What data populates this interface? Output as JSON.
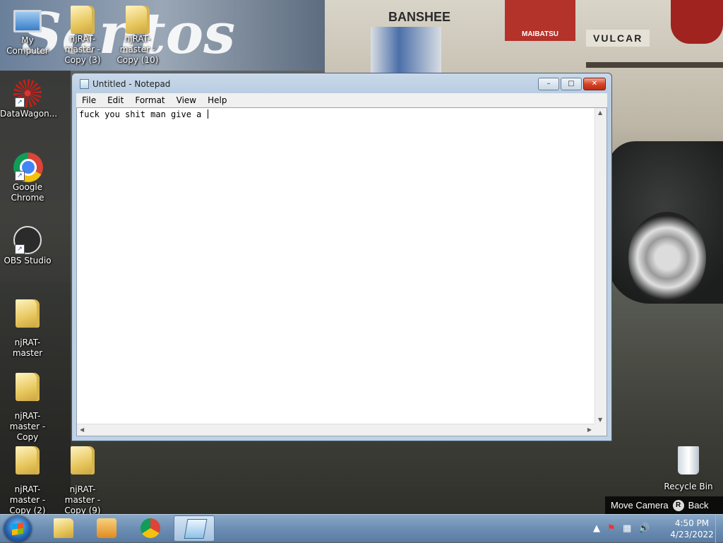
{
  "wallpaper": {
    "sign_banshee": "BANSHEE",
    "sign_maibatsu": "MAIBATSU",
    "sign_vulcar": "VULCAR",
    "santos_text": "Santos"
  },
  "desktop_icons": [
    {
      "label": "My Computer",
      "kind": "computer"
    },
    {
      "label": "njRAT-master - Copy (3)",
      "kind": "folder"
    },
    {
      "label": "njRAT-master - Copy (10)",
      "kind": "folder"
    },
    {
      "label": "DataWagon...",
      "kind": "datawagon"
    },
    {
      "label": "Google Chrome",
      "kind": "chrome"
    },
    {
      "label": "OBS Studio",
      "kind": "obs"
    },
    {
      "label": "njRAT-master",
      "kind": "folder"
    },
    {
      "label": "njRAT-master - Copy",
      "kind": "folder"
    },
    {
      "label": "njRAT-master - Copy (2)",
      "kind": "folder"
    },
    {
      "label": "njRAT-master - Copy (9)",
      "kind": "folder"
    },
    {
      "label": "Recycle Bin",
      "kind": "recycle-bin"
    }
  ],
  "notepad": {
    "title": "Untitled - Notepad",
    "menu": [
      "File",
      "Edit",
      "Format",
      "View",
      "Help"
    ],
    "content": "fuck you shit man give a ",
    "min_label": "–",
    "max_label": "□",
    "close_label": "✕"
  },
  "game_hint": {
    "action": "Move Camera",
    "button": "R",
    "back": "Back"
  },
  "taskbar": {
    "pinned": [
      "windows-explorer",
      "windows-media-player",
      "google-chrome",
      "notepad"
    ],
    "active": "notepad",
    "time": "4:50 PM",
    "date": "4/23/2022",
    "tray_icons": [
      "show-hidden-icons",
      "action-center-flag",
      "network",
      "volume"
    ]
  }
}
